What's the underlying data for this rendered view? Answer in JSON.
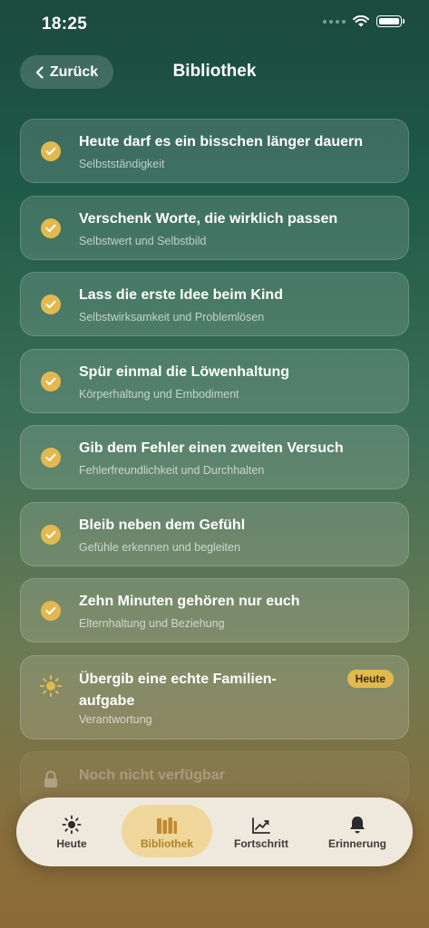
{
  "status_bar": {
    "time": "18:25"
  },
  "nav": {
    "back_label": "Zurück",
    "title": "Bibliothek"
  },
  "colors": {
    "accent": "#e2b94e",
    "tab_active": "#efd79b"
  },
  "list": [
    {
      "title": "Heute darf es ein bisschen länger dauern",
      "subtitle": "Selbstständigkeit",
      "state": "done",
      "icon": "check-icon"
    },
    {
      "title": "Verschenk Worte, die wirklich passen",
      "subtitle": "Selbstwert und Selbstbild",
      "state": "done",
      "icon": "check-icon"
    },
    {
      "title": "Lass die erste Idee beim Kind",
      "subtitle": "Selbstwirksamkeit und Problemlösen",
      "state": "done",
      "icon": "check-icon"
    },
    {
      "title": "Spür einmal die Löwenhaltung",
      "subtitle": "Körperhaltung und Embodiment",
      "state": "done",
      "icon": "check-icon"
    },
    {
      "title": "Gib dem Fehler einen zweiten Versuch",
      "subtitle": "Fehlerfreundlichkeit und Durchhalten",
      "state": "done",
      "icon": "check-icon"
    },
    {
      "title": "Bleib neben dem Gefühl",
      "subtitle": "Gefühle erkennen und begleiten",
      "state": "done",
      "icon": "check-icon"
    },
    {
      "title": "Zehn Minuten gehören nur euch",
      "subtitle": "Elternhaltung und Beziehung",
      "state": "done",
      "icon": "check-icon"
    }
  ],
  "today_item": {
    "title": "Übergib eine echte Familien-aufgabe",
    "subtitle": "Verantwortung",
    "badge": "Heute",
    "icon": "sun-icon"
  },
  "locked_item": {
    "title": "Noch nicht verfügbar",
    "icon": "lock-icon"
  },
  "tabs": [
    {
      "label": "Heute",
      "icon": "sun-icon",
      "active": false
    },
    {
      "label": "Bibliothek",
      "icon": "books-icon",
      "active": true
    },
    {
      "label": "Fortschritt",
      "icon": "chart-icon",
      "active": false
    },
    {
      "label": "Erinnerung",
      "icon": "bell-icon",
      "active": false
    }
  ]
}
